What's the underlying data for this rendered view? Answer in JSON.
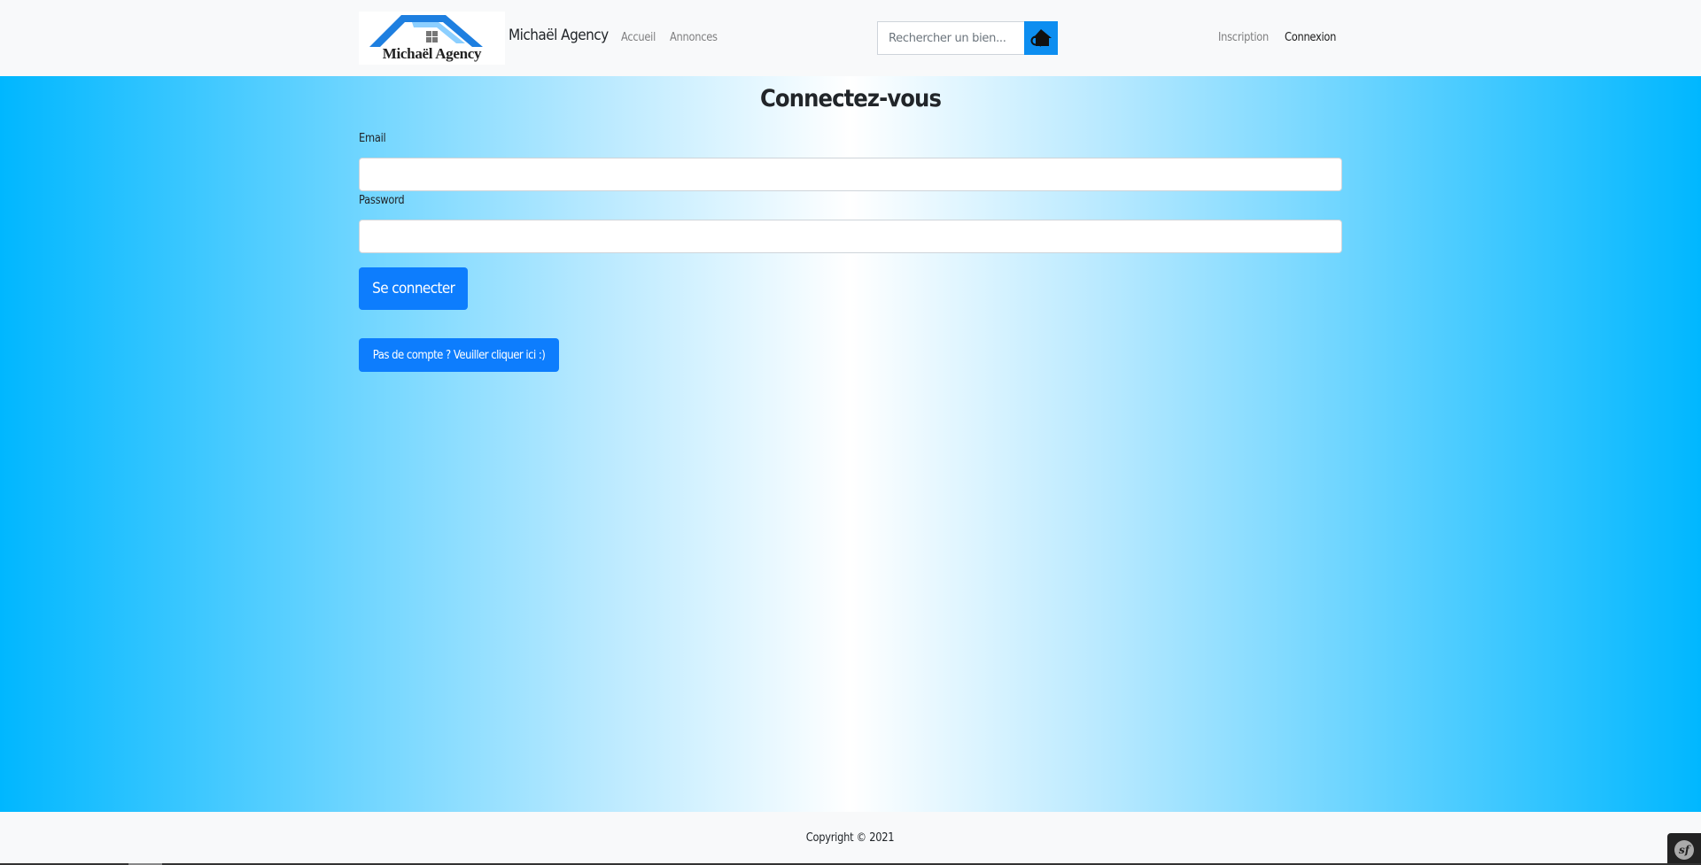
{
  "colors": {
    "primary": "#0d7dfd",
    "navbar_bg": "#f8f9fa",
    "gradient_edge": "#00b7ff",
    "gradient_center": "#ffffff"
  },
  "navbar": {
    "logo_text": "Michaël Agency",
    "brand": "Michaël Agency",
    "links": [
      {
        "label": "Accueil"
      },
      {
        "label": "Annonces"
      }
    ],
    "search": {
      "placeholder": "Rechercher un bien...",
      "button_icon": "house-search-icon"
    },
    "auth_links": [
      {
        "label": "Inscription"
      },
      {
        "label": "Connexion"
      }
    ]
  },
  "login": {
    "title": "Connectez-vous",
    "email_label": "Email",
    "password_label": "Password",
    "submit_label": "Se connecter",
    "register_label": "Pas de compte ? Veuiller cliquer ici :)"
  },
  "footer": {
    "copyright": "Copyright © 2021",
    "toolbar_icon": "symfony-icon",
    "toolbar_text": "sf"
  }
}
